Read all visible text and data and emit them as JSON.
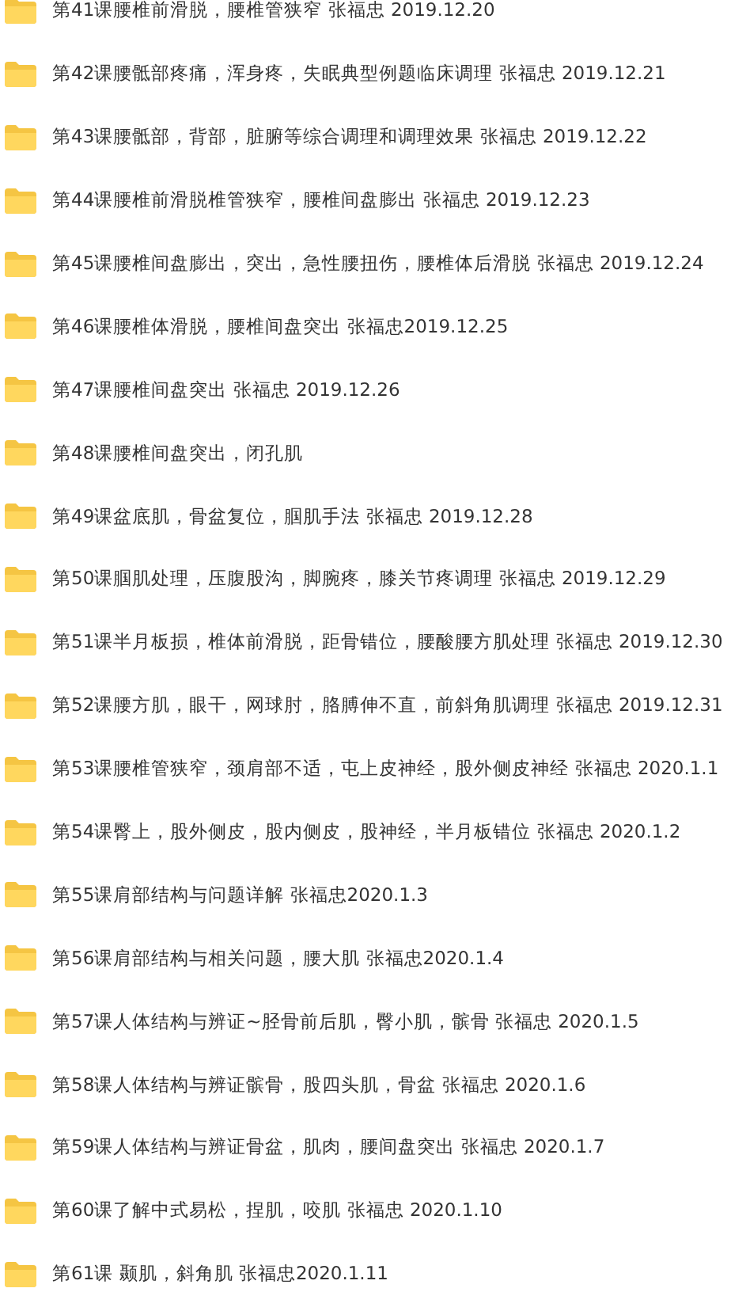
{
  "folders": [
    {
      "name": "第41课腰椎前滑脱，腰椎管狭窄 张福忠 2019.12.20"
    },
    {
      "name": "第42课腰骶部疼痛，浑身疼，失眠典型例题临床调理 张福忠 2019.12.21"
    },
    {
      "name": "第43课腰骶部，背部，脏腑等综合调理和调理效果 张福忠 2019.12.22"
    },
    {
      "name": "第44课腰椎前滑脱椎管狭窄，腰椎间盘膨出 张福忠 2019.12.23"
    },
    {
      "name": "第45课腰椎间盘膨出，突出，急性腰扭伤，腰椎体后滑脱 张福忠 2019.12.24"
    },
    {
      "name": "第46课腰椎体滑脱，腰椎间盘突出 张福忠2019.12.25"
    },
    {
      "name": "第47课腰椎间盘突出 张福忠  2019.12.26"
    },
    {
      "name": "第48课腰椎间盘突出，闭孔肌"
    },
    {
      "name": "第49课盆底肌，骨盆复位，腘肌手法 张福忠 2019.12.28"
    },
    {
      "name": "第50课腘肌处理，压腹股沟，脚腕疼，膝关节疼调理 张福忠 2019.12.29"
    },
    {
      "name": "第51课半月板损，椎体前滑脱，距骨错位，腰酸腰方肌处理 张福忠 2019.12.30"
    },
    {
      "name": "第52课腰方肌，眼干，网球肘，胳膊伸不直，前斜角肌调理 张福忠 2019.12.31"
    },
    {
      "name": "第53课腰椎管狭窄，颈肩部不适，屯上皮神经，股外侧皮神经 张福忠 2020.1.1"
    },
    {
      "name": "第54课臀上，股外侧皮，股内侧皮，股神经，半月板错位 张福忠 2020.1.2"
    },
    {
      "name": "第55课肩部结构与问题详解 张福忠2020.1.3"
    },
    {
      "name": "第56课肩部结构与相关问题，腰大肌 张福忠2020.1.4"
    },
    {
      "name": "第57课人体结构与辨证~胫骨前后肌，臀小肌，髌骨 张福忠 2020.1.5"
    },
    {
      "name": "第58课人体结构与辨证髌骨，股四头肌，骨盆 张福忠 2020.1.6"
    },
    {
      "name": "第59课人体结构与辨证骨盆，肌肉，腰间盘突出 张福忠 2020.1.7"
    },
    {
      "name": "第60课了解中式易松，捏肌，咬肌 张福忠 2020.1.10"
    },
    {
      "name": "第61课 颞肌，斜角肌 张福忠2020.1.11"
    }
  ]
}
